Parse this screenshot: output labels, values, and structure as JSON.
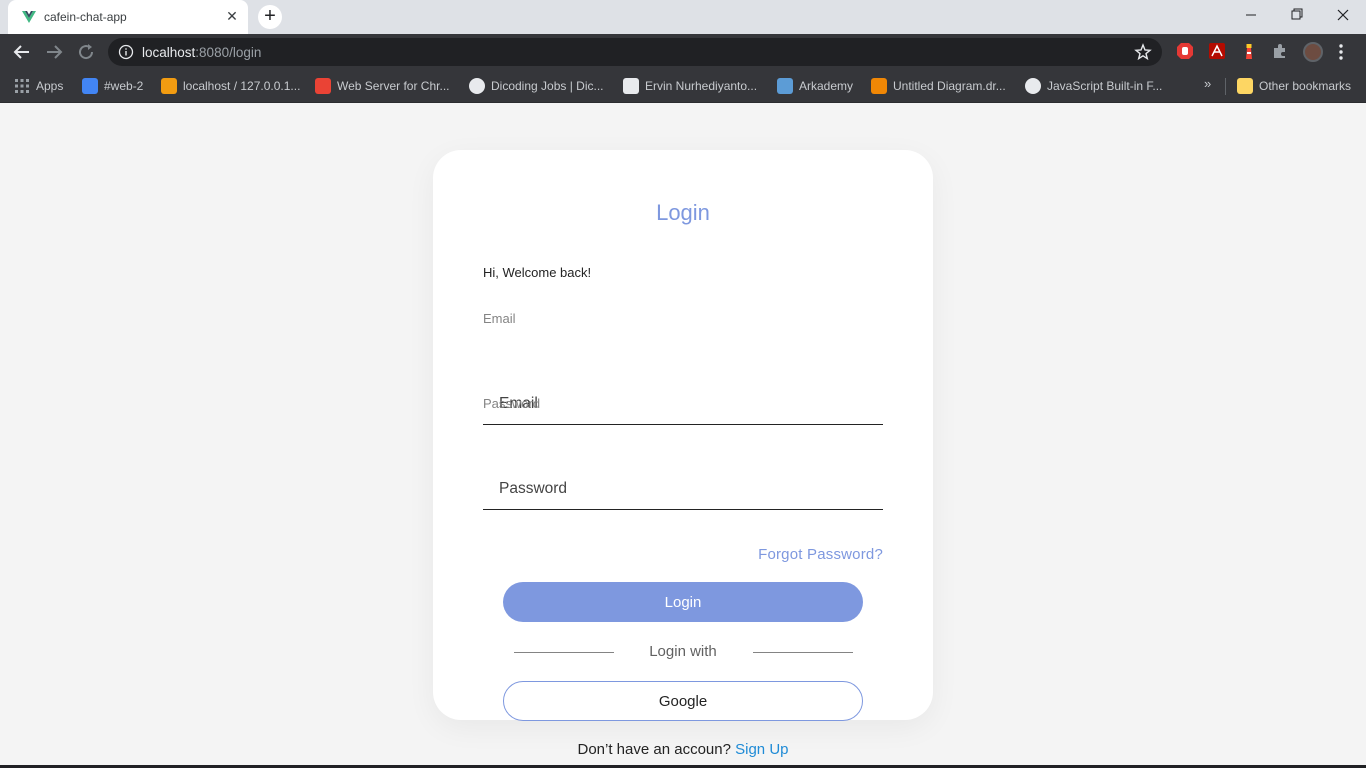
{
  "browser": {
    "tab_title": "cafein-chat-app",
    "url_host": "localhost",
    "url_port_path": ":8080/login",
    "bookmarks": [
      {
        "label": "Apps",
        "icon": "apps-grid-icon",
        "color": "#9aa0a6"
      },
      {
        "label": "#web-2",
        "icon": "web2-favicon",
        "color": "#4285f4"
      },
      {
        "label": "localhost / 127.0.0.1...",
        "icon": "phpmyadmin-favicon",
        "color": "#f29c11"
      },
      {
        "label": "Web Server for Chr...",
        "icon": "web-server-favicon",
        "color": "#ea4335"
      },
      {
        "label": "Dicoding Jobs | Dic...",
        "icon": "dicoding-favicon",
        "color": "#e8eaed"
      },
      {
        "label": "Ervin Nurhediyanto...",
        "icon": "profile-favicon",
        "color": "#e8eaed"
      },
      {
        "label": "Arkademy",
        "icon": "arkademy-favicon",
        "color": "#5c9cd6"
      },
      {
        "label": "Untitled Diagram.dr...",
        "icon": "drawio-favicon",
        "color": "#f08705"
      },
      {
        "label": "JavaScript Built-in F...",
        "icon": "js-favicon",
        "color": "#e8eaed"
      }
    ],
    "other_bookmarks": "Other bookmarks",
    "more_bookmarks": "»"
  },
  "login": {
    "title": "Login",
    "welcome": "Hi, Welcome back!",
    "email_label": "Email",
    "email_placeholder": "Email",
    "password_label": "Password",
    "password_placeholder": "Password",
    "forgot_password": "Forgot Password?",
    "login_button": "Login",
    "login_with": "Login with",
    "google_button": "Google",
    "no_account": "Don’t have an accoun?",
    "sign_up": "Sign Up"
  },
  "colors": {
    "accent": "#7e98df",
    "link": "#1f8bd6",
    "page_bg": "#f4f4f4"
  }
}
